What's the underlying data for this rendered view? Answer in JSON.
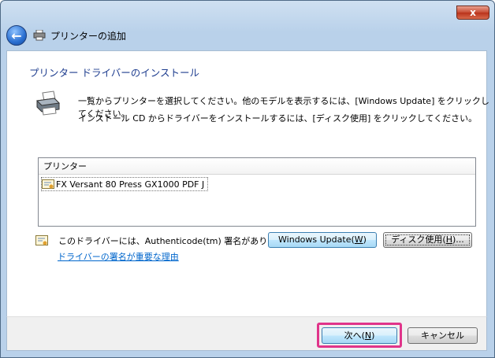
{
  "window": {
    "title": "プリンターの追加",
    "close_label": "x"
  },
  "main": {
    "heading": "プリンター ドライバーのインストール",
    "instruction_line1": "一覧からプリンターを選択してください。他のモデルを表示するには、[Windows Update] をクリックしてください。",
    "instruction_line2": "インストール CD からドライバーをインストールするには、[ディスク使用] をクリックしてください。"
  },
  "printer_list": {
    "header": "プリンター",
    "items": [
      "FX Versant 80 Press GX1000 PDF J"
    ]
  },
  "signature": {
    "text": "このドライバーには、Authenticode(tm) 署名があります。",
    "link": "ドライバーの署名が重要な理由"
  },
  "buttons": {
    "windows_update": "Windows Update(",
    "windows_update_key": "W",
    "disk": "ディスク使用(",
    "disk_key": "H",
    "disk_suffix": ")...",
    "next": "次へ(",
    "next_key": "N",
    "cancel": "キャンセル",
    "close_paren": ")"
  },
  "colors": {
    "heading": "#1e3d8f",
    "link": "#0066cc",
    "highlight": "#e0348a"
  },
  "icons": [
    "back-arrow-icon",
    "printer-icon",
    "certificate-icon",
    "shield-icon",
    "close-icon"
  ]
}
